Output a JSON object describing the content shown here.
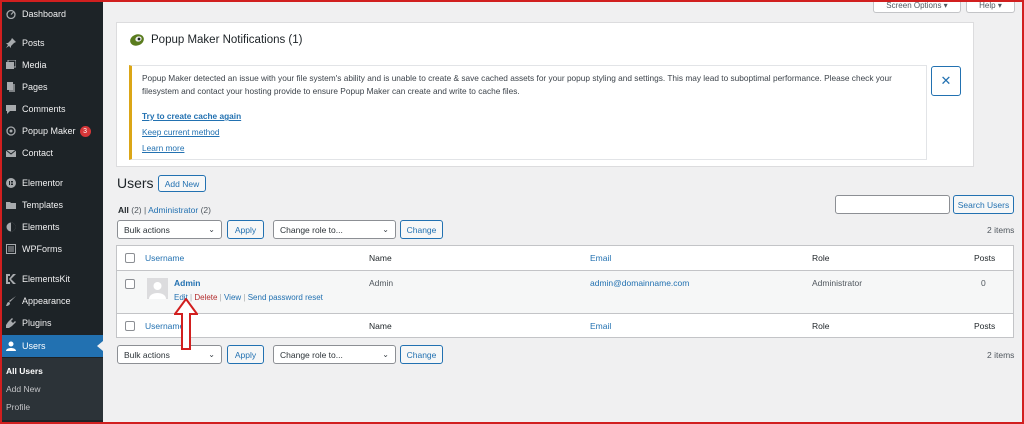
{
  "sidebar": {
    "items": [
      {
        "label": "Dashboard",
        "icon": "dashboard-icon"
      },
      {
        "label": "Posts",
        "icon": "pin-icon"
      },
      {
        "label": "Media",
        "icon": "media-icon"
      },
      {
        "label": "Pages",
        "icon": "pages-icon"
      },
      {
        "label": "Comments",
        "icon": "comment-icon"
      },
      {
        "label": "Popup Maker",
        "icon": "popup-maker-icon",
        "badge": "3"
      },
      {
        "label": "Contact",
        "icon": "envelope-icon"
      },
      {
        "label": "Elementor",
        "icon": "elementor-icon"
      },
      {
        "label": "Templates",
        "icon": "folder-icon"
      },
      {
        "label": "Elements",
        "icon": "elements-icon"
      },
      {
        "label": "WPForms",
        "icon": "forms-icon"
      },
      {
        "label": "ElementsKit",
        "icon": "elementskit-icon"
      },
      {
        "label": "Appearance",
        "icon": "brush-icon"
      },
      {
        "label": "Plugins",
        "icon": "plug-icon"
      },
      {
        "label": "Users",
        "icon": "user-icon"
      }
    ],
    "submenu": [
      "All Users",
      "Add New",
      "Profile"
    ]
  },
  "top": {
    "screen_options": "Screen Options ▾",
    "help": "Help ▾"
  },
  "notice": {
    "title": "Popup Maker Notifications (1)",
    "message_line1": "Popup Maker detected an issue with your file system's ability and is unable to create & save cached assets for your popup styling and settings. This may lead to suboptimal performance. Please check your",
    "message_line2": "filesystem and contact your hosting provide to ensure Popup Maker can create and write to cache files.",
    "link_try": "Try to create cache again",
    "link_keep": "Keep current method",
    "link_learn": "Learn more",
    "close": "✕"
  },
  "users": {
    "title": "Users",
    "add_new": "Add New",
    "view_all": "All",
    "view_all_count": "(2)",
    "view_separator": "|",
    "view_admin": "Administrator",
    "view_admin_count": "(2)",
    "search_button": "Search Users",
    "bulk_actions": "Bulk actions",
    "apply": "Apply",
    "change_role": "Change role to...",
    "change": "Change",
    "items_count": "2 items"
  },
  "table": {
    "columns": [
      "Username",
      "Name",
      "Email",
      "Role",
      "Posts"
    ],
    "rows": [
      {
        "username": "Admin",
        "name": "Admin",
        "email": "admin@domainname.com",
        "role": "Administrator",
        "posts": "0",
        "actions": {
          "edit": "Edit",
          "delete": "Delete",
          "view": "View",
          "reset": "Send password reset"
        }
      }
    ]
  },
  "colors": {
    "sidebar_bg": "#1d2327",
    "accent": "#2271b1",
    "highlight_border": "#d11f1f",
    "warning": "#dba617"
  }
}
